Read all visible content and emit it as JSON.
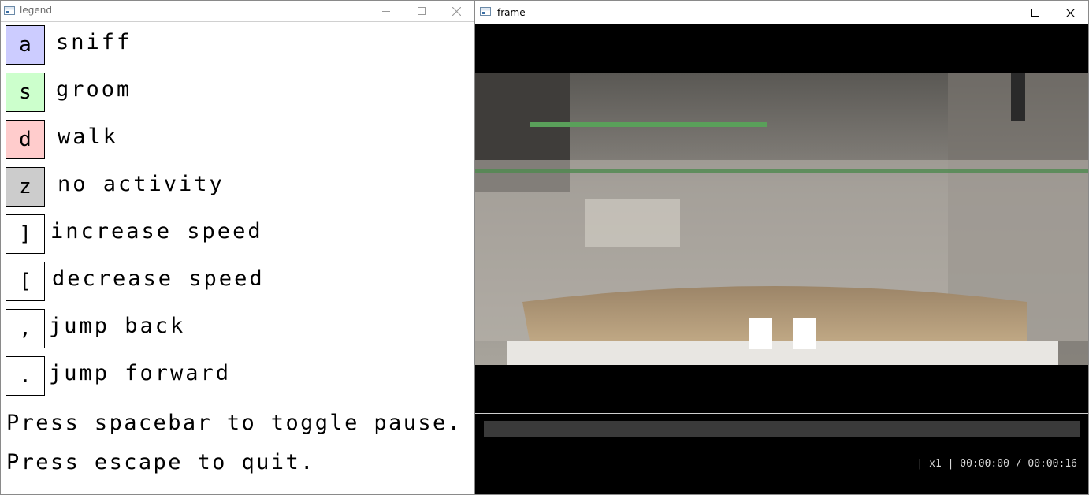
{
  "legend_window": {
    "title": "legend",
    "keys": [
      {
        "key": "a",
        "label": "sniff",
        "color": "#ccccff"
      },
      {
        "key": "s",
        "label": "groom",
        "color": "#ccffcc"
      },
      {
        "key": "d",
        "label": "walk",
        "color": "#ffcccc"
      },
      {
        "key": "z",
        "label": "no activity",
        "color": "#cccccc"
      },
      {
        "key": "]",
        "label": "increase speed",
        "color": "#ffffff"
      },
      {
        "key": "[",
        "label": "decrease speed",
        "color": "#ffffff"
      },
      {
        "key": ",",
        "label": "jump back",
        "color": "#ffffff"
      },
      {
        "key": ".",
        "label": "jump forward",
        "color": "#ffffff"
      }
    ],
    "help": [
      "Press spacebar to toggle pause.",
      "Press escape to quit."
    ]
  },
  "frame_window": {
    "title": "frame",
    "status": "| x1 | 00:00:00 / 00:00:16",
    "playback": {
      "speed": "x1",
      "current_time": "00:00:00",
      "total_time": "00:00:16",
      "paused": true,
      "progress": 0
    }
  },
  "colors": {
    "frame_background": "#000000",
    "seekbar": "#3a3a3a",
    "status_text": "#d8d8d8"
  },
  "icons": [
    "app-window-icon",
    "minimize-icon",
    "maximize-icon",
    "close-icon",
    "pause-icon"
  ]
}
